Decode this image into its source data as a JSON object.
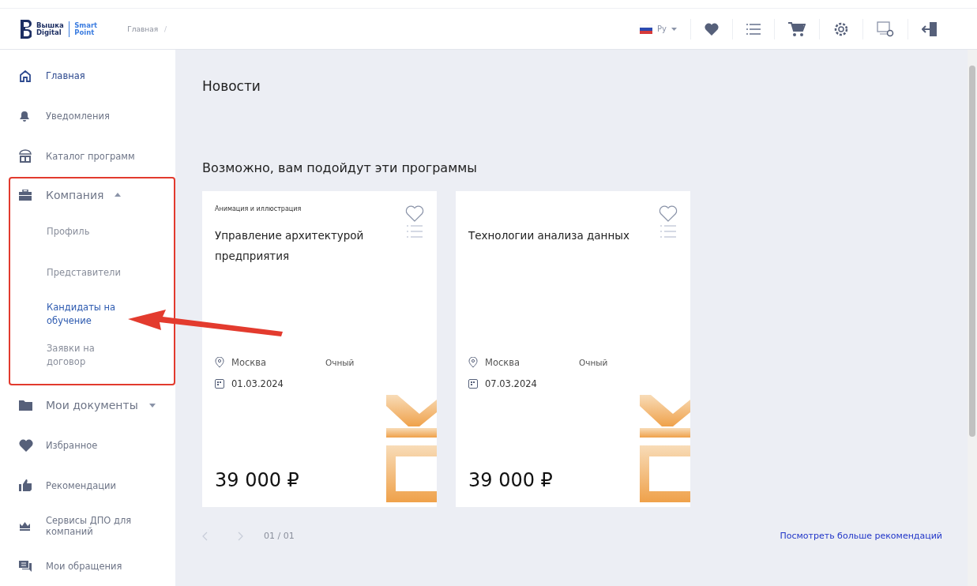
{
  "header": {
    "logo": {
      "brand_top": "Вышка",
      "brand_bottom": "Digital",
      "product_top": "Smart",
      "product_bottom": "Point"
    },
    "breadcrumbs": [
      "Главная"
    ],
    "breadcrumb_separator": "/",
    "language": "Ру"
  },
  "sidebar": {
    "items": [
      {
        "label": "Главная",
        "selected": true
      },
      {
        "label": "Уведомления",
        "selected": false
      },
      {
        "label": "Каталог программ",
        "selected": false
      },
      {
        "label": "Компания",
        "selected": false,
        "expanded": true,
        "children": [
          {
            "label": "Профиль",
            "selected": false
          },
          {
            "label": "Представители",
            "selected": false
          },
          {
            "label": "Кандидаты на обучение",
            "selected": true
          },
          {
            "label": "Заявки на договор",
            "selected": false
          }
        ]
      },
      {
        "label": "Мои документы",
        "selected": false,
        "expanded": false
      },
      {
        "label": "Избранное",
        "selected": false
      },
      {
        "label": "Рекомендации",
        "selected": false
      },
      {
        "label": "Сервисы ДПО для компаний",
        "selected": false
      },
      {
        "label": "Мои обращения",
        "selected": false
      }
    ]
  },
  "main": {
    "news_title": "Новости",
    "recommendations": {
      "title": "Возможно, вам подойдут эти программы",
      "cards": [
        {
          "category": "Анимация и иллюстрация",
          "title": "Управление архитектурой предприятия",
          "city": "Москва",
          "format": "Очный",
          "date": "01.03.2024",
          "price": "39 000 ₽",
          "favorite": false
        },
        {
          "title": "Технологии анализа данных",
          "city": "Москва",
          "format": "Очный",
          "date": "07.03.2024",
          "price": "39 000 ₽",
          "favorite": false
        }
      ],
      "pager": "01 / 01",
      "more_link": "Посмотреть больше рекомендаций"
    }
  }
}
